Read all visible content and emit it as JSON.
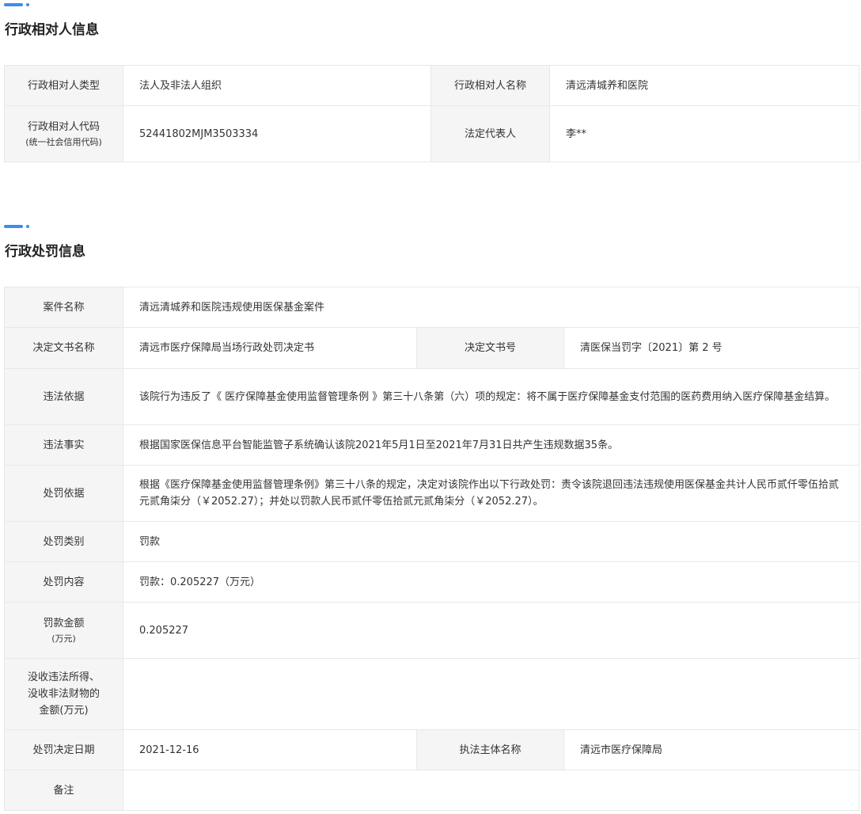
{
  "section1": {
    "title": "行政相对人信息",
    "rows": {
      "type_label": "行政相对人类型",
      "type_value": "法人及非法人组织",
      "name_label": "行政相对人名称",
      "name_value": "清远清城养和医院",
      "code_label": "行政相对人代码",
      "code_sublabel": "(统一社会信用代码)",
      "code_value": "52441802MJM3503334",
      "rep_label": "法定代表人",
      "rep_value": "李**"
    }
  },
  "section2": {
    "title": "行政处罚信息",
    "rows": {
      "case_name_label": "案件名称",
      "case_name_value": "清远清城养和医院违规使用医保基金案件",
      "doc_name_label": "决定文书名称",
      "doc_name_value": "清远市医疗保障局当场行政处罚决定书",
      "doc_no_label": "决定文书号",
      "doc_no_value": "清医保当罚字〔2021〕第 2 号",
      "violation_basis_label": "违法依据",
      "violation_basis_value": "该院行为违反了《 医疗保障基金使用监督管理条例 》第三十八条第（六）项的规定：将不属于医疗保障基金支付范围的医药费用纳入医疗保障基金结算。",
      "violation_facts_label": "违法事实",
      "violation_facts_value": "根据国家医保信息平台智能监管子系统确认该院2021年5月1日至2021年7月31日共产生违规数据35条。",
      "penalty_basis_label": "处罚依据",
      "penalty_basis_value": "根据《医疗保障基金使用监督管理条例》第三十八条的规定，决定对该院作出以下行政处罚：责令该院退回违法违规使用医保基金共计人民币贰仟零伍拾贰元贰角柒分（￥2052.27）；并处以罚款人民币贰仟零伍拾贰元贰角柒分（￥2052.27）。",
      "penalty_type_label": "处罚类别",
      "penalty_type_value": "罚款",
      "penalty_content_label": "处罚内容",
      "penalty_content_value": "罚款：0.205227（万元）",
      "fine_amount_label": "罚款金额",
      "fine_amount_unit": "(万元)",
      "fine_amount_value": "0.205227",
      "confiscation_label_1": "没收违法所得、",
      "confiscation_label_2": "没收非法财物的",
      "confiscation_label_3": "金额(万元)",
      "confiscation_value": "",
      "decision_date_label": "处罚决定日期",
      "decision_date_value": "2021-12-16",
      "authority_label": "执法主体名称",
      "authority_value": "清远市医疗保障局",
      "remarks_label": "备注",
      "remarks_value": ""
    }
  },
  "colors": {
    "accent": "#3b8eea",
    "label_bg": "#f5f5f5",
    "border": "#e8e8e8"
  }
}
